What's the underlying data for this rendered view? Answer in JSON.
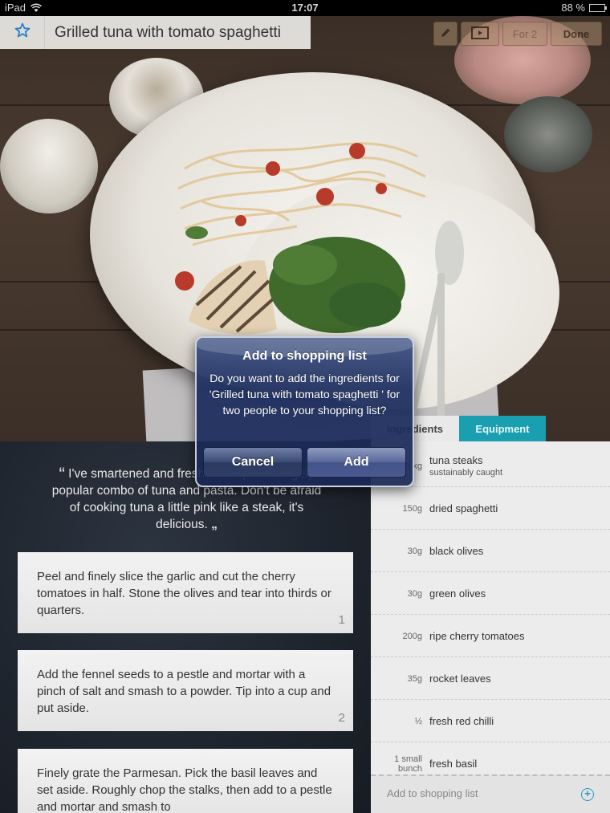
{
  "status_bar": {
    "device": "iPad",
    "time": "17:07",
    "battery": "88 %",
    "battery_level": 0.88
  },
  "header": {
    "title": "Grilled tuna with tomato spaghetti",
    "star_icon": "star-outline-icon",
    "toolbar": {
      "edit_icon": "pencil-icon",
      "video_icon": "video-icon",
      "servings_label": "For 2",
      "done_label": "Done"
    }
  },
  "intro": {
    "open_quote": "“",
    "text": "I've smartened and freshened up that hugely popular combo of tuna and pasta. Don't be afraid of cooking tuna a little pink like a steak, it's delicious.",
    "close_quote": "„"
  },
  "steps": [
    {
      "text": "Peel and finely slice the garlic and cut the cherry tomatoes in half. Stone the olives and tear into thirds or quarters.",
      "number": "1"
    },
    {
      "text": "Add the fennel seeds to a pestle and mortar with a pinch of salt and smash to a powder. Tip into a cup and put aside.",
      "number": "2"
    },
    {
      "text": "Finely grate the Parmesan. Pick the basil leaves and set aside. Roughly chop the stalks, then add to a pestle and mortar and smash to",
      "number": ""
    }
  ],
  "tabs": {
    "ingredients": "Ingredients",
    "equipment": "Equipment"
  },
  "ingredients": [
    {
      "qty": "2 x 1 kg",
      "name": "tuna steaks",
      "note": "sustainably caught"
    },
    {
      "qty": "150g",
      "name": "dried spaghetti",
      "note": ""
    },
    {
      "qty": "30g",
      "name": "black olives",
      "note": ""
    },
    {
      "qty": "30g",
      "name": "green olives",
      "note": ""
    },
    {
      "qty": "200g",
      "name": "ripe cherry tomatoes",
      "note": ""
    },
    {
      "qty": "35g",
      "name": "rocket leaves",
      "note": ""
    },
    {
      "qty": "½",
      "name": "fresh red chilli",
      "note": ""
    },
    {
      "qty": "1 small bunch",
      "name": "fresh basil",
      "note": ""
    }
  ],
  "shopping": {
    "label": "Add to shopping list",
    "icon": "plus-circle-icon"
  },
  "alert": {
    "title": "Add to shopping list",
    "message": "Do you want to add the ingredients for 'Grilled tuna with tomato spaghetti ' for two people to your shopping list?",
    "cancel_label": "Cancel",
    "add_label": "Add"
  },
  "colors": {
    "accent_teal": "#1a9fb0",
    "star_blue": "#2a7ec8",
    "alert_blue": "#1c2d5f"
  }
}
